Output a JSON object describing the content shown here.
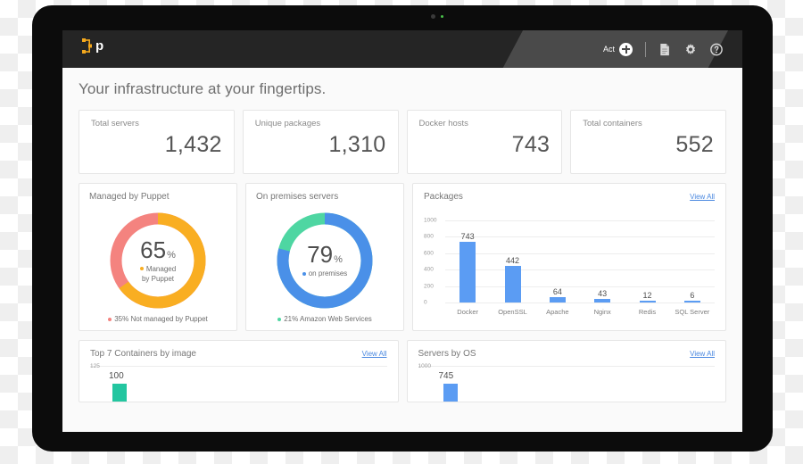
{
  "header": {
    "logo_letter": "p",
    "logo_icon": "puppet-logo-icon",
    "act_label": "Act",
    "add_icon": "plus-circle-icon",
    "doc_icon": "document-icon",
    "gear_icon": "gear-icon",
    "help_icon": "help-circle-icon"
  },
  "page": {
    "title": "Your infrastructure at your fingertips."
  },
  "stats": [
    {
      "label": "Total servers",
      "value": "1,432"
    },
    {
      "label": "Unique packages",
      "value": "1,310"
    },
    {
      "label": "Docker hosts",
      "value": "743"
    },
    {
      "label": "Total containers",
      "value": "552"
    }
  ],
  "donuts": [
    {
      "title": "Managed by Puppet",
      "percent": "65",
      "percent_sign": "%",
      "sub_line1": "Managed",
      "sub_line2": "by Puppet",
      "footer": "35% Not managed by Puppet",
      "primary_color": "#f9ae22",
      "secondary_color": "#f4837f",
      "primary_value": 65,
      "secondary_value": 35
    },
    {
      "title": "On premises servers",
      "percent": "79",
      "percent_sign": "%",
      "sub_line1": "on premises",
      "sub_line2": "",
      "footer": "21% Amazon Web Services",
      "primary_color": "#4a90e8",
      "secondary_color": "#4ed6a2",
      "primary_value": 79,
      "secondary_value": 21
    }
  ],
  "packages": {
    "title": "Packages",
    "view_all": "View All"
  },
  "bottom_cards": [
    {
      "title": "Top 7 Containers by image",
      "view_all": "View All",
      "y_top": "125",
      "first_value": "100",
      "bar_color": "#23c6a0"
    },
    {
      "title": "Servers by OS",
      "view_all": "View All",
      "y_top": "1000",
      "first_value": "745",
      "bar_color": "#5b9cf3"
    }
  ],
  "chart_data": {
    "type": "bar",
    "title": "Packages",
    "categories": [
      "Docker",
      "OpenSSL",
      "Apache",
      "Nginx",
      "Redis",
      "SQL Server"
    ],
    "values": [
      743,
      442,
      64,
      43,
      12,
      6
    ],
    "xlabel": "",
    "ylabel": "",
    "ylim": [
      0,
      1000
    ],
    "yticks": [
      0,
      200,
      400,
      600,
      800,
      1000
    ],
    "grid": true,
    "legend": false,
    "bar_color": "#5b9cf3",
    "data_labels": true
  }
}
